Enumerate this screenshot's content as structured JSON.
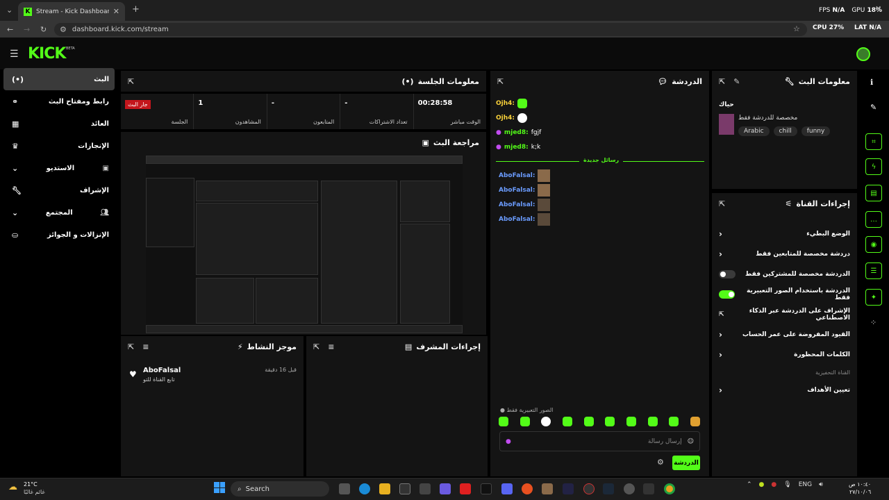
{
  "browser": {
    "tab_title": "Stream - Kick Dashboard",
    "url": "dashboard.kick.com/stream"
  },
  "hud": {
    "fps_label": "FPS",
    "fps_value": "N/A",
    "gpu_label": "GPU",
    "gpu_value": "18%",
    "cpu_label": "CPU",
    "cpu_value": "27%",
    "lat_label": "LAT",
    "lat_value": "N/A"
  },
  "brand": {
    "logo": "KICK",
    "beta": "BETA",
    "accent": "#53fc18"
  },
  "nav": [
    {
      "label": "البث",
      "icon": "(•)",
      "selected": true
    },
    {
      "label": "رابط ومفتاح البث",
      "icon": "🔗"
    },
    {
      "label": "العائد",
      "icon": "▦"
    },
    {
      "label": "الإنجازات",
      "icon": "🏆"
    },
    {
      "label": "الاستديو",
      "icon": "▣",
      "expandable": true
    },
    {
      "label": "الإشراف",
      "icon": "🔧"
    },
    {
      "label": "المجتمع",
      "icon": "👥",
      "expandable": true
    },
    {
      "label": "الإنزالات و الجوائز",
      "icon": "⛀"
    }
  ],
  "session": {
    "title": "معلومات الجلسة",
    "stats": [
      {
        "value": "00:28:58",
        "label": "الوقت مباشر"
      },
      {
        "value": "-",
        "label": "تعداد الاشتراكات"
      },
      {
        "value": "-",
        "label": "المتابعون"
      },
      {
        "value": "1",
        "label": "المشاهدون"
      },
      {
        "value": "جار البث",
        "label": "الجلسة"
      }
    ]
  },
  "preview": {
    "title": "مراجعة البث"
  },
  "chat": {
    "title": "الدردشة",
    "messages": [
      {
        "user": "Ojh4:",
        "text": ""
      },
      {
        "user": "Ojh4:",
        "text": ""
      },
      {
        "user": "mjed8:",
        "text": "fgjf"
      },
      {
        "user": "mjed8:",
        "text": "k;k"
      }
    ],
    "new_messages": "رسائل جديدة",
    "new_users": [
      {
        "user": "AboFalsal:"
      },
      {
        "user": "AboFalsal:"
      },
      {
        "user": "AboFalsal:"
      },
      {
        "user": "AboFalsal:"
      }
    ],
    "emote_note": "الصور التعبيرية فقط",
    "input_placeholder": "إرسال رسالة",
    "send_label": "الدردشة"
  },
  "stream_info": {
    "title": "معلومات البث",
    "stream_title": "حياك",
    "category": "مخصصة للدردشة فقط",
    "tags": [
      "Arabic",
      "chill",
      "funny"
    ]
  },
  "channel_actions": {
    "title": "إجراءات القناة",
    "items": [
      {
        "label": "الوضع البطيء",
        "type": "chevron"
      },
      {
        "label": "دردشة مخصصة للمتابعين فقط",
        "type": "chevron"
      },
      {
        "label": "الدردشة مخصصة للمشتركين فقط",
        "type": "toggle",
        "on": false
      },
      {
        "label": "الدردشة باستخدام الصور التعبيرية فقط",
        "type": "toggle",
        "on": true
      },
      {
        "label": "الإشراف على الدردشة عبر الذكاء الاصطناعي",
        "type": "link"
      },
      {
        "label": "القيود المفروضة على عمر الحساب",
        "type": "chevron"
      },
      {
        "label": "الكلمات المحظورة",
        "type": "chevron"
      }
    ],
    "section_label": "القناة التحفيزية",
    "goals_label": "تعيين الأهداف"
  },
  "activity": {
    "title": "موجز النشاط",
    "items": [
      {
        "user": "AboFalsal",
        "action": "تابع القناة للتو",
        "time": "قبل 16 دقيقة"
      }
    ]
  },
  "mod_actions": {
    "title": "إجراءات المشرف"
  },
  "taskbar": {
    "temp": "21°C",
    "weather": "غائم غالبًا",
    "search": "Search",
    "lang": "ENG",
    "time": "١٠:٤٠ ص",
    "date": "٢٧/١٠/٠٦"
  }
}
